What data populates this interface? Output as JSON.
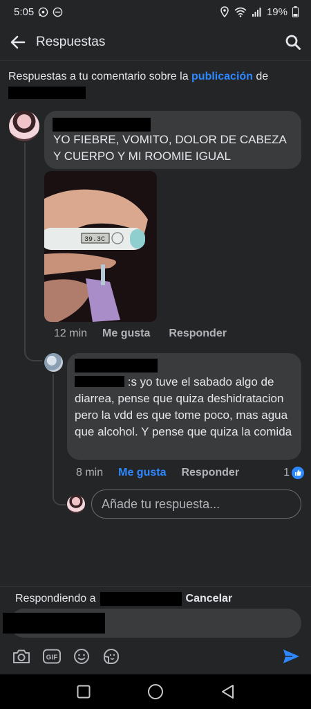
{
  "status_bar": {
    "time": "5:05",
    "battery": "19%"
  },
  "header": {
    "title": "Respuestas"
  },
  "context": {
    "prefix": "Respuestas a tu comentario sobre la ",
    "link": "publicación",
    "suffix": " de"
  },
  "comment": {
    "text": "YO FIEBRE, VOMITO, DOLOR DE CABEZA Y CUERPO Y MI ROOMIE IGUAL",
    "thermometer_reading": "39.3C",
    "time": "12 min",
    "like_label": "Me gusta",
    "reply_label": "Responder"
  },
  "reply": {
    "text_line1": ":s yo tuve el sabado algo de",
    "text_rest": "diarrea, pense que quiza deshidratacion pero la vdd es que tome poco, mas agua que alcohol. Y pense que quiza la comida",
    "time": "8 min",
    "like_label": "Me gusta",
    "reply_label": "Responder",
    "reaction_count": "1"
  },
  "reply_input": {
    "placeholder": "Añade tu respuesta..."
  },
  "responding_bar": {
    "prefix": "Respondiendo a",
    "cancel_label": "Cancelar"
  },
  "colors": {
    "background": "#242526",
    "bubble": "#3a3b3c",
    "accent": "#2d88ff",
    "text": "#e4e6eb",
    "muted": "#b0b3b8"
  }
}
